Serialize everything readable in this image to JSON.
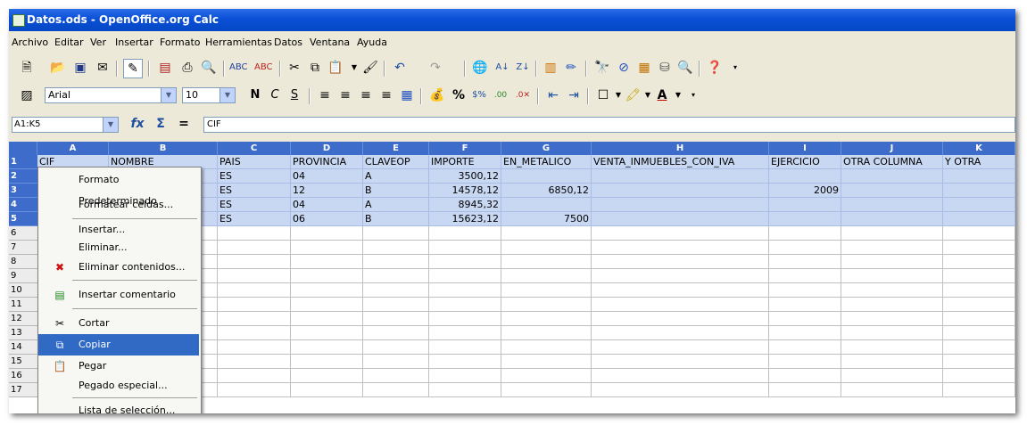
{
  "window": {
    "title": "Datos.ods - OpenOffice.org Calc"
  },
  "menu": [
    "Archivo",
    "Editar",
    "Ver",
    "Insertar",
    "Formato",
    "Herramientas",
    "Datos",
    "Ventana",
    "Ayuda"
  ],
  "format_bar": {
    "font_name": "Arial",
    "font_size": "10",
    "bold": "N",
    "italic": "C",
    "underline": "S"
  },
  "formula_bar": {
    "name_box": "A1:K5",
    "content": "CIF"
  },
  "columns": [
    "A",
    "B",
    "C",
    "D",
    "E",
    "F",
    "G",
    "H",
    "I",
    "J",
    "K"
  ],
  "rows": [
    "1",
    "2",
    "3",
    "4",
    "5",
    "6",
    "7",
    "8",
    "9",
    "10",
    "11",
    "12",
    "13",
    "14",
    "15",
    "16",
    "17"
  ],
  "cells": {
    "A1": "CIF",
    "B1": "NOMBRE",
    "C1": "PAIS",
    "D1": "PROVINCIA",
    "E1": "CLAVEOP",
    "F1": "IMPORTE",
    "G1": "EN_METALICO",
    "H1": "VENTA_INMUEBLES_CON_IVA",
    "I1": "EJERCICIO",
    "J1": "OTRA COLUMNA",
    "K1": "Y OTRA",
    "C2": "ES",
    "D2": "04",
    "E2": "A",
    "F2": "3500,12",
    "C3": "ES",
    "D3": "12",
    "E3": "B",
    "F3": "14578,12",
    "G3": "6850,12",
    "I3": "2009",
    "C4": "ES",
    "D4": "04",
    "E4": "A",
    "F4": "8945,32",
    "C5": "ES",
    "D5": "06",
    "E5": "B",
    "F5": "15623,12",
    "G5": "7500"
  },
  "context_menu": [
    {
      "label": "Formato Predeterminado",
      "icon": ""
    },
    {
      "label": "Formatear celdas...",
      "icon": ""
    },
    {
      "label": "Insertar...",
      "icon": ""
    },
    {
      "label": "Eliminar...",
      "icon": ""
    },
    {
      "label": "Eliminar contenidos...",
      "icon": "delete-x-icon"
    },
    {
      "label": "Insertar comentario",
      "icon": "comment-icon"
    },
    {
      "label": "Cortar",
      "icon": "scissors-icon"
    },
    {
      "label": "Copiar",
      "icon": "copy-icon",
      "highlighted": true
    },
    {
      "label": "Pegar",
      "icon": "paste-icon"
    },
    {
      "label": "Pegado especial...",
      "icon": ""
    },
    {
      "label": "Lista de selección...",
      "icon": ""
    }
  ]
}
